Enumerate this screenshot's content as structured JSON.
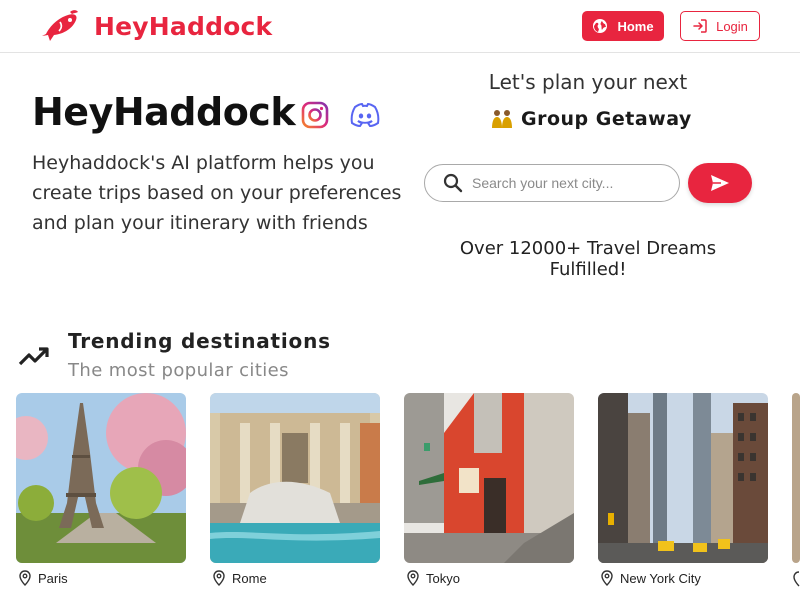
{
  "header": {
    "brand": "HeyHaddock",
    "home_label": "Home",
    "login_label": "Login"
  },
  "hero": {
    "title": "HeyHaddock",
    "description": "Heyhaddock's AI platform helps you create trips based on your preferences and plan your itinerary with friends",
    "plan_line": "Let's plan your next",
    "trip_type": "Group Getaway",
    "search_placeholder": "Search your next city...",
    "stats": "Over 12000+ Travel Dreams Fulfilled!"
  },
  "trending": {
    "title": "Trending destinations",
    "subtitle": "The most popular cities",
    "cities": [
      {
        "name": "Paris"
      },
      {
        "name": "Rome"
      },
      {
        "name": "Tokyo"
      },
      {
        "name": "New York City"
      }
    ]
  },
  "colors": {
    "accent": "#e8253f",
    "text": "#1a1a1a",
    "muted": "#888888"
  },
  "icons": [
    "fish-logo-icon",
    "globe-icon",
    "login-icon",
    "instagram-icon",
    "discord-icon",
    "group-icon",
    "search-icon",
    "send-icon",
    "trending-up-icon",
    "location-pin-icon"
  ]
}
